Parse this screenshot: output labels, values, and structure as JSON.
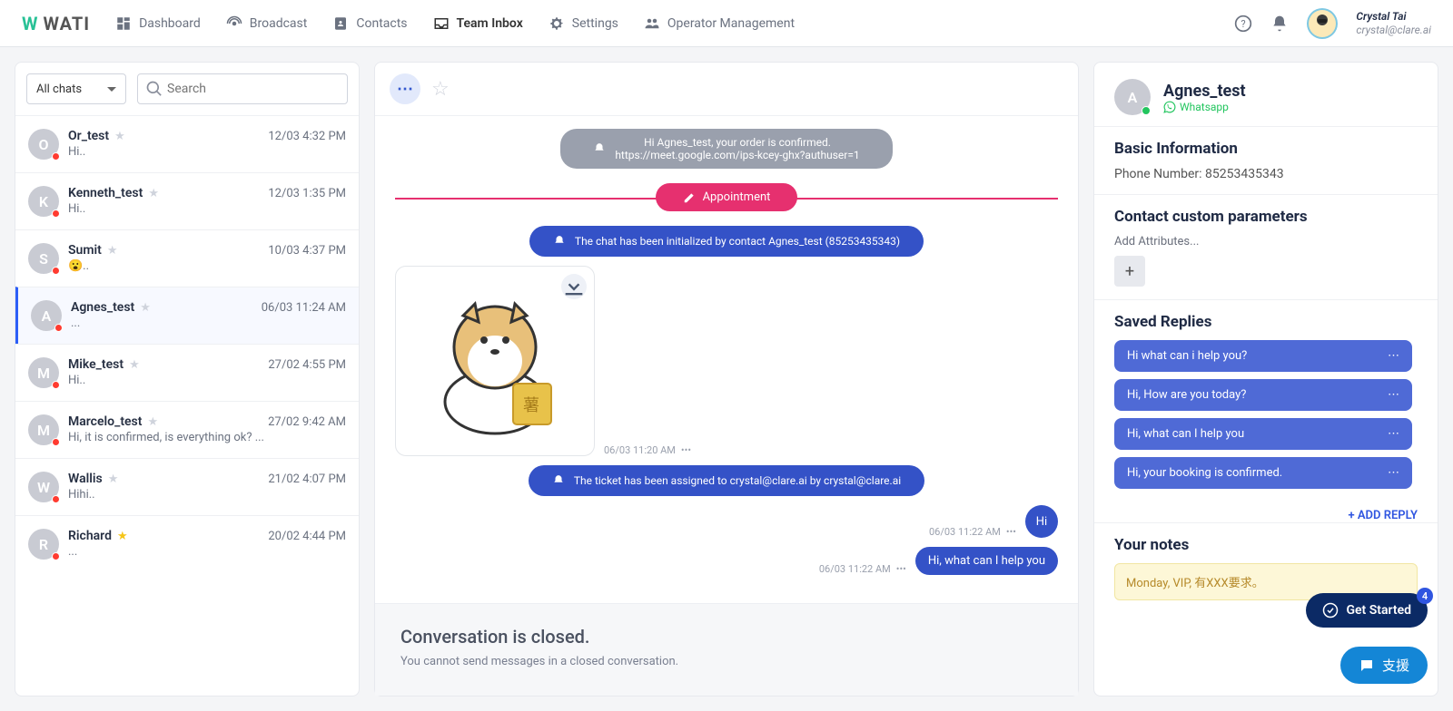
{
  "brand": "WATI",
  "nav": [
    {
      "label": "Dashboard"
    },
    {
      "label": "Broadcast"
    },
    {
      "label": "Contacts"
    },
    {
      "label": "Team Inbox"
    },
    {
      "label": "Settings"
    },
    {
      "label": "Operator Management"
    }
  ],
  "user": {
    "name": "Crystal Tai",
    "email": "crystal@clare.ai"
  },
  "left": {
    "filter": "All chats",
    "search_placeholder": "Search",
    "chats": [
      {
        "initial": "O",
        "name": "Or_test",
        "time": "12/03 4:32 PM",
        "preview": "Hi..",
        "fav": false
      },
      {
        "initial": "K",
        "name": "Kenneth_test",
        "time": "12/03 1:35 PM",
        "preview": "Hi..",
        "fav": false
      },
      {
        "initial": "S",
        "name": "Sumit",
        "time": "10/03 4:37 PM",
        "preview": "😮..",
        "fav": false
      },
      {
        "initial": "A",
        "name": "Agnes_test",
        "time": "06/03 11:24 AM",
        "preview": "...",
        "fav": false,
        "active": true
      },
      {
        "initial": "M",
        "name": "Mike_test",
        "time": "27/02 4:55 PM",
        "preview": "Hi..",
        "fav": false
      },
      {
        "initial": "M",
        "name": "Marcelo_test",
        "time": "27/02 9:42 AM",
        "preview": "Hi, it is confirmed, is everything ok? ...",
        "fav": false
      },
      {
        "initial": "W",
        "name": "Wallis",
        "time": "21/02 4:07 PM",
        "preview": "Hihi..",
        "fav": false
      },
      {
        "initial": "R",
        "name": "Richard",
        "time": "20/02 4:44 PM",
        "preview": "...",
        "fav": true
      }
    ]
  },
  "conversation": {
    "order_line1": "Hi Agnes_test, your order is confirmed.",
    "order_line2": "https://meet.google.com/ips-kcey-ghx?authuser=1",
    "appointment_label": "Appointment",
    "init_notice": "The chat has been initialized by contact Agnes_test (85253435343)",
    "sticker_time": "06/03 11:20 AM",
    "ticket_notice": "The ticket has been assigned to crystal@clare.ai by crystal@clare.ai",
    "msg_hi": "Hi",
    "msg_hi_time": "06/03 11:22 AM",
    "msg_help": "Hi, what can I help you",
    "msg_help_time": "06/03 11:22 AM",
    "closed_title": "Conversation is closed.",
    "closed_body": "You cannot send messages in a closed conversation."
  },
  "contact": {
    "initial": "A",
    "name": "Agnes_test",
    "channel": "Whatsapp",
    "section_basic": "Basic Information",
    "phone_label": "Phone Number:",
    "phone_value": "85253435343",
    "section_params": "Contact custom parameters",
    "add_attr": "Add Attributes...",
    "section_replies": "Saved Replies",
    "replies": [
      "Hi what can i help you?",
      "Hi, How are you today?",
      "Hi, what can I help you",
      "Hi, your booking is confirmed."
    ],
    "add_reply": "+ ADD REPLY",
    "section_notes": "Your notes",
    "notes": "Monday, VIP, 有XXX要求。"
  },
  "floating": {
    "get_started": "Get Started",
    "get_started_badge": "4",
    "support": "支援"
  }
}
